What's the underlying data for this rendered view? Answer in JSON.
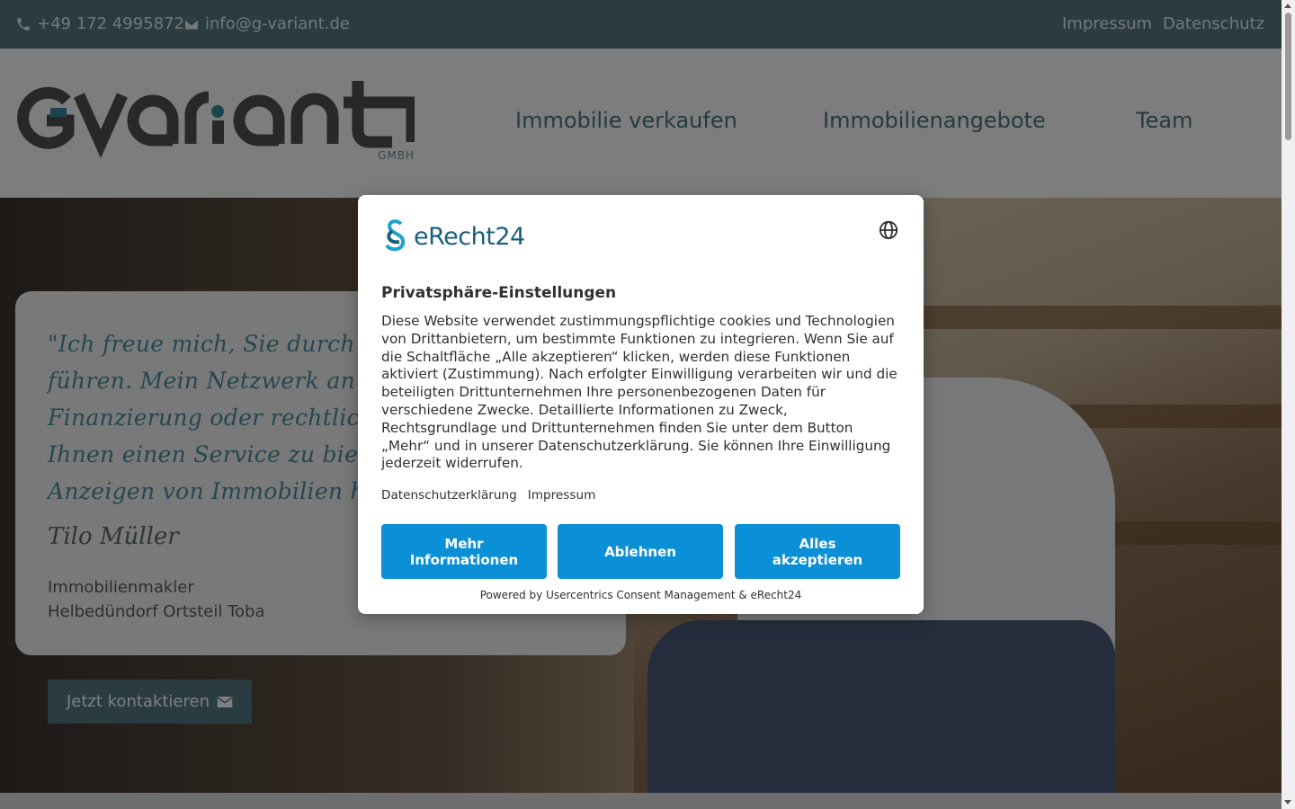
{
  "topbar": {
    "phone": "+49 172 4995872",
    "email": "info@g-variant.de",
    "links": [
      "Impressum",
      "Datenschutz"
    ]
  },
  "header": {
    "logo_text": "GVARIANT",
    "logo_sub": "GMBH",
    "nav": [
      "Immobilie verkaufen",
      "Immobilienangebote",
      "Team"
    ]
  },
  "hero": {
    "quote_lines": [
      "\"Ich freue mich, Sie durch den Ve",
      "führen. Mein Netzwerk an Konta",
      "Finanzierung oder rechtliche Bera",
      "Ihnen einen Service zu bieten, d",
      "Anzeigen von Immobilien hinausgeh"
    ],
    "signature": "Tilo Müller",
    "role": "Immobilienmakler",
    "location": "Helbedündorf Ortsteil Toba",
    "cta_label": "Jetzt kontaktieren"
  },
  "consent": {
    "brand": "eRecht24",
    "title": "Privatsphäre-Einstellungen",
    "body": "Diese Website verwendet zustimmungspflichtige cookies und Technologien von Drittanbietern, um bestimmte Funktionen zu integrieren. Wenn Sie auf die Schaltfläche „Alle akzeptieren“ klicken, werden diese Funktionen aktiviert (Zustimmung). Nach erfolgter Einwilligung verarbeiten wir und die beteiligten Drittunternehmen Ihre personenbezogenen Daten für verschiedene Zwecke. Detaillierte Informationen zu Zweck, Rechtsgrundlage und Drittunternehmen finden Sie unter dem Button „Mehr“ und in unserer Datenschutzerklärung. Sie können Ihre Einwilligung jederzeit widerrufen.",
    "link_privacy": "Datenschutzerklärung",
    "link_imprint": "Impressum",
    "btn_more": "Mehr Informationen",
    "btn_deny": "Ablehnen",
    "btn_accept": "Alles akzeptieren",
    "powered": "Powered by Usercentrics Consent Management & eRecht24"
  },
  "colors": {
    "brand_teal": "#547885",
    "consent_button": "#0b8fd6",
    "quote_text": "#4b8ea4"
  }
}
